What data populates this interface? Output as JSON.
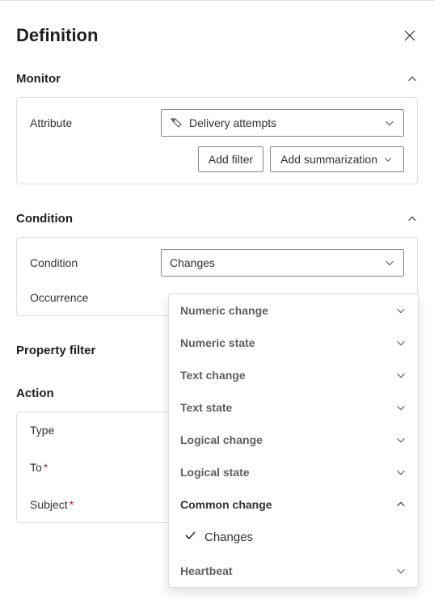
{
  "header": {
    "title": "Definition"
  },
  "sections": {
    "monitor": {
      "title": "Monitor",
      "expanded": true
    },
    "condition": {
      "title": "Condition",
      "expanded": true
    },
    "property_filter": {
      "title": "Property filter"
    },
    "action": {
      "title": "Action",
      "expanded": true
    }
  },
  "monitor": {
    "attribute_label": "Attribute",
    "attribute_value": "Delivery attempts",
    "add_filter_label": "Add filter",
    "add_summarization_label": "Add summarization"
  },
  "condition": {
    "condition_label": "Condition",
    "condition_value": "Changes",
    "occurrence_label": "Occurrence"
  },
  "action": {
    "type_label": "Type",
    "to_label": "To",
    "subject_label": "Subject"
  },
  "dropdown": {
    "items": [
      {
        "label": "Numeric change",
        "expanded": false
      },
      {
        "label": "Numeric state",
        "expanded": false
      },
      {
        "label": "Text change",
        "expanded": false
      },
      {
        "label": "Text state",
        "expanded": false
      },
      {
        "label": "Logical change",
        "expanded": false
      },
      {
        "label": "Logical state",
        "expanded": false
      },
      {
        "label": "Common change",
        "expanded": true,
        "selected_option": "Changes"
      },
      {
        "label": "Heartbeat",
        "expanded": false
      }
    ]
  }
}
